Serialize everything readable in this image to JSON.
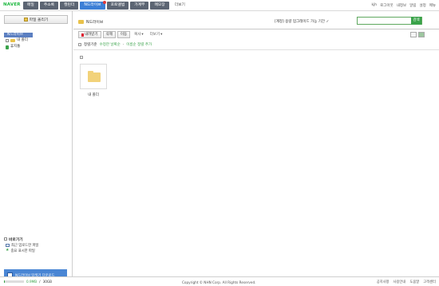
{
  "brand": {
    "logo": "NAVER",
    "accent": "#3aa34a"
  },
  "gnb": {
    "tabs": [
      "메일",
      "주소록",
      "캘린더",
      "N드라이브",
      "포토앨범",
      "가계부",
      "메모장",
      "더보기"
    ],
    "active_index": 3
  },
  "userbar": [
    "kjh",
    "로그아웃",
    "내정보",
    "알림",
    "설정",
    "메뉴"
  ],
  "sidebar": {
    "upload_label": "파일 올리기",
    "tree_root": "N드라이브",
    "tree_items": [
      "내 폴더",
      "휴지통"
    ],
    "quick_title": "바로가기",
    "quick_items": [
      "최근 업로드한 파일",
      "중요 표시한 파일"
    ],
    "banner": "N드라이브 탐색기 다운로드"
  },
  "main": {
    "breadcrumb": "N드라이브",
    "promo": "[계정] 용량 업그레이드 가능 기간 ✓",
    "search_placeholder": "",
    "search_button": "검색",
    "toolbar": [
      "내려받기",
      "삭제",
      "이동",
      "복사",
      "더보기"
    ],
    "filters": {
      "label": "정렬기준",
      "options": [
        "수정한 날짜순",
        "이름순 정렬 추가"
      ]
    },
    "folder_name": "내 폴더"
  },
  "footer": {
    "usage_used": "0.9MB",
    "usage_total": "30GB",
    "usage_fraction": 0.05,
    "copyright": "Copyright © NHN Corp. All Rights Reserved.",
    "links": [
      "공지사항",
      "사용안내",
      "도움말",
      "고객센터"
    ]
  }
}
